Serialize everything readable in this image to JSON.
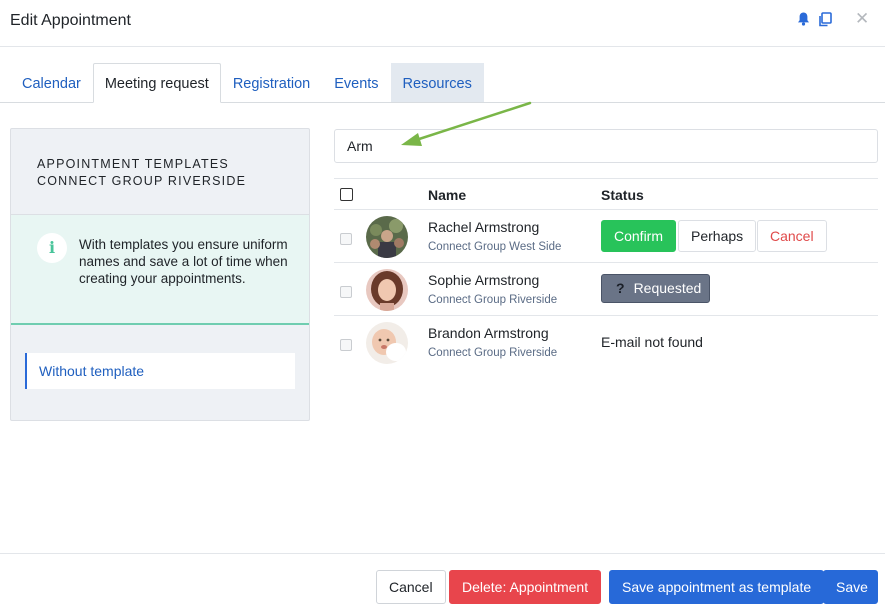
{
  "window": {
    "title": "Edit Appointment"
  },
  "tabs": [
    {
      "label": "Calendar"
    },
    {
      "label": "Meeting request"
    },
    {
      "label": "Registration"
    },
    {
      "label": "Events"
    },
    {
      "label": "Resources"
    }
  ],
  "sidebar": {
    "heading_line1": "APPOINTMENT TEMPLATES",
    "heading_line2": "CONNECT GROUP RIVERSIDE",
    "info_text": "With templates you ensure uniform names and save a lot of time when creating your appointments.",
    "template_item": "Without template"
  },
  "search": {
    "value": "Arm"
  },
  "table": {
    "columns": {
      "name": "Name",
      "status": "Status"
    },
    "rows": [
      {
        "name": "Rachel Armstrong",
        "group": "Connect Group West Side",
        "actions": {
          "confirm": "Confirm",
          "perhaps": "Perhaps",
          "cancel": "Cancel"
        }
      },
      {
        "name": "Sophie Armstrong",
        "group": "Connect Group Riverside",
        "status": "Requested"
      },
      {
        "name": "Brandon Armstrong",
        "group": "Connect Group Riverside",
        "status": "E-mail not found"
      }
    ]
  },
  "footer": {
    "cancel": "Cancel",
    "delete": "Delete: Appointment",
    "save_template": "Save appointment as template",
    "save": "Save"
  },
  "colors": {
    "accent": "#2769d8",
    "confirm": "#28c35a",
    "danger": "#e8454c",
    "annotation_arrow": "#7ab648"
  }
}
